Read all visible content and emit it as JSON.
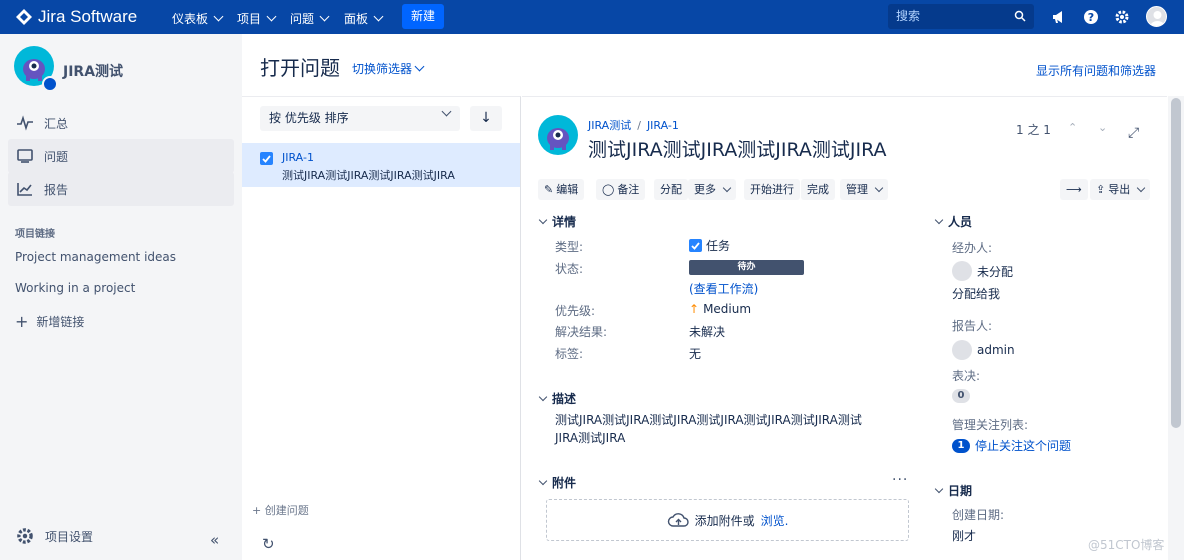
{
  "topbar": {
    "brand": "Jira Software",
    "nav": [
      "仪表板",
      "项目",
      "问题",
      "面板"
    ],
    "create_label": "新建",
    "search_placeholder": "搜索"
  },
  "sidebar": {
    "project_name": "JIRA测试",
    "items": [
      {
        "label": "汇总",
        "icon": "activity-icon"
      },
      {
        "label": "问题",
        "icon": "issues-icon"
      },
      {
        "label": "报告",
        "icon": "reports-icon"
      }
    ],
    "section_label": "项目链接",
    "links": [
      "Project management ideas",
      "Working in a project"
    ],
    "add_link": "新增链接",
    "settings": "项目设置"
  },
  "header": {
    "title": "打开问题",
    "filter_switch": "切换筛选器",
    "show_all": "显示所有问题和筛选器"
  },
  "list": {
    "sort_label": "按 优先级 排序",
    "issues": [
      {
        "key": "JIRA-1",
        "summary": "测试JIRA测试JIRA测试JIRA测试JIRA"
      }
    ],
    "create_issue": "+ 创建问题"
  },
  "detail": {
    "breadcrumb_project": "JIRA测试",
    "breadcrumb_key": "JIRA-1",
    "title": "测试JIRA测试JIRA测试JIRA测试JIRA",
    "pager": "1 之 1",
    "toolbar": {
      "edit": "编辑",
      "comment": "备注",
      "assign": "分配",
      "more": "更多",
      "start": "开始进行",
      "done": "完成",
      "admin": "管理",
      "export": "导出"
    },
    "details_heading": "详情",
    "fields": {
      "type_label": "类型:",
      "type_value": "任务",
      "status_label": "状态:",
      "status_value": "待办",
      "workflow_link": "(查看工作流)",
      "priority_label": "优先级:",
      "priority_value": "Medium",
      "resolution_label": "解决结果:",
      "resolution_value": "未解决",
      "labels_label": "标签:",
      "labels_value": "无"
    },
    "description_heading": "描述",
    "description_line1": "测试JIRA测试JIRA测试JIRA测试JIRA测试JIRA测试JIRA测试",
    "description_line2": "JIRA测试JIRA",
    "attachments_heading": "附件",
    "attach_text": "添加附件或",
    "attach_browse": "浏览.",
    "people": {
      "heading": "人员",
      "assignee_label": "经办人:",
      "assignee_value": "未分配",
      "assign_to_me": "分配给我",
      "reporter_label": "报告人:",
      "reporter_value": "admin",
      "votes_label": "表决:",
      "votes_count": "0",
      "watchers_label": "管理关注列表:",
      "watchers_count": "1",
      "stop_watching": "停止关注这个问题"
    },
    "dates": {
      "heading": "日期",
      "created_label": "创建日期:",
      "created_value": "刚才"
    }
  },
  "watermark": "@51CTO博客"
}
